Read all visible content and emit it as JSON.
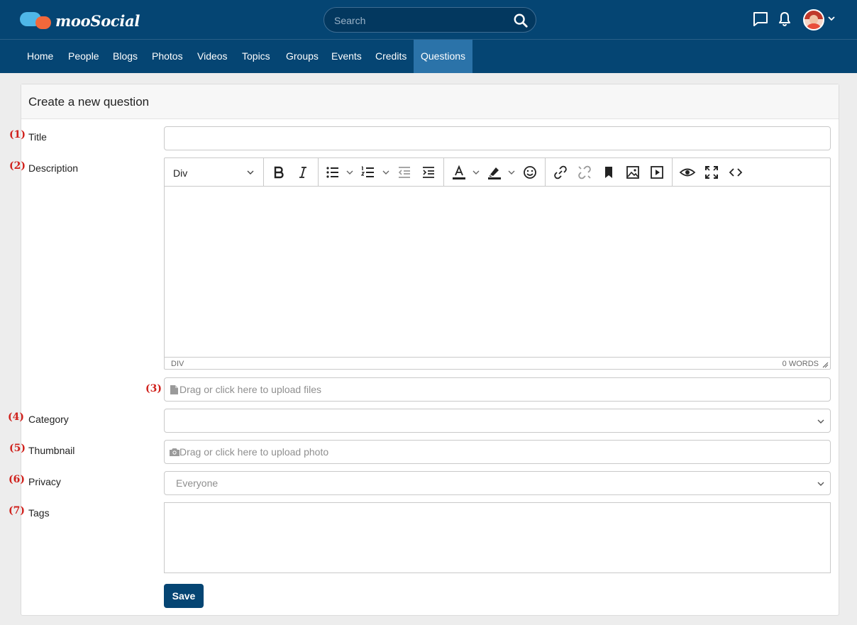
{
  "app": {
    "logo_text": "mooSocial"
  },
  "header": {
    "search_placeholder": "Search",
    "icons": [
      "search-icon",
      "chat-icon",
      "bell-icon",
      "chevron-down-icon"
    ]
  },
  "nav": {
    "items": [
      {
        "label": "Home"
      },
      {
        "label": "People"
      },
      {
        "label": "Blogs"
      },
      {
        "label": "Photos"
      },
      {
        "label": "Videos"
      },
      {
        "label": "Topics"
      },
      {
        "label": "Groups"
      },
      {
        "label": "Events"
      },
      {
        "label": "Credits"
      },
      {
        "label": "Questions",
        "active": true
      }
    ]
  },
  "form": {
    "title": "Create a new question",
    "markers": [
      "(1)",
      "(2)",
      "(3)",
      "(4)",
      "(5)",
      "(6)",
      "(7)"
    ],
    "fields": {
      "title_label": "Title",
      "title_value": "",
      "description_label": "Description",
      "files_upload_text": "Drag or click here to upload files",
      "category_label": "Category",
      "category_value": "",
      "thumbnail_label": "Thumbnail",
      "thumbnail_upload_text": "Drag or click here to upload photo",
      "privacy_label": "Privacy",
      "privacy_value": "Everyone",
      "tags_label": "Tags",
      "tags_value": ""
    },
    "editor": {
      "block_format": "Div",
      "status_path": "DIV",
      "word_count": "0 WORDS",
      "content": ""
    },
    "save_label": "Save"
  },
  "colors": {
    "brand": "#054573",
    "nav_active": "#2b73a9",
    "marker": "#d0211c"
  }
}
